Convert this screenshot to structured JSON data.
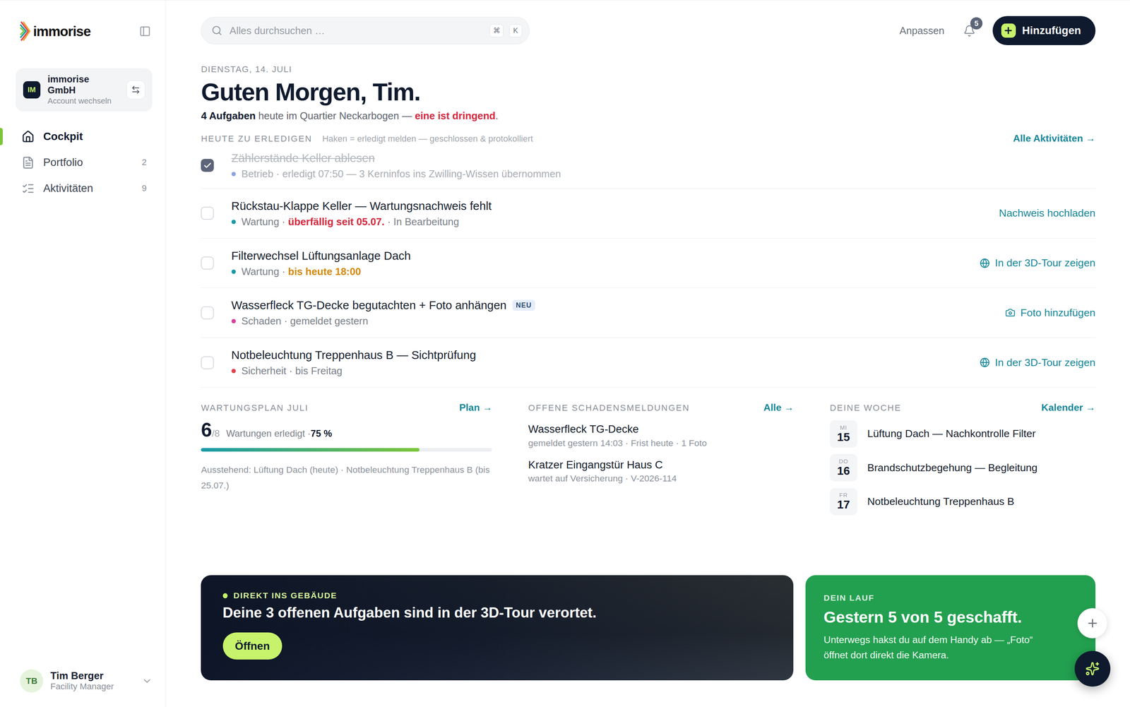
{
  "sidebar": {
    "logo": "immorise",
    "account": {
      "initials": "IM",
      "name": "immorise GmbH",
      "sub": "Account wechseln"
    },
    "items": [
      {
        "label": "Cockpit",
        "count": "",
        "selected": true,
        "kind": "home"
      },
      {
        "label": "Portfolio",
        "count": "2",
        "selected": false,
        "kind": "portfolio"
      },
      {
        "label": "Aktivitäten",
        "count": "9",
        "selected": false,
        "kind": "activities"
      }
    ],
    "user": {
      "initials": "TB",
      "name": "Tim Berger",
      "role": "Facility Manager"
    }
  },
  "topbar": {
    "search": {
      "placeholder": "Alles durchsuchen …",
      "keys": [
        "⌘",
        "K"
      ]
    },
    "customize": "Anpassen",
    "notifications": "5",
    "add": "Hinzufügen"
  },
  "greeting": {
    "date": "DIENSTAG, 14. JULI",
    "title": "Guten Morgen, Tim.",
    "summary": [
      {
        "text": "4 Aufgaben",
        "tone": "strong"
      },
      {
        "text": " heute im Quartier Neckarbogen — ",
        "tone": "normal"
      },
      {
        "text": "eine ist dringend",
        "tone": "urgent"
      },
      {
        "text": ".",
        "tone": "normal"
      }
    ]
  },
  "tasks": {
    "title": "HEUTE ZU ERLEDIGEN",
    "hint": "Haken = erledigt melden — geschlossen & protokolliert",
    "link": "Alle Aktivitäten →",
    "items": [
      {
        "title": "Zählerstände Keller ablesen",
        "checked": true,
        "badge": "",
        "category": "Betrieb",
        "color": "#8fa3e0",
        "meta": [
          {
            "text": " · erledigt 07:50 — 3 Kerninfos ins Zwilling-Wissen übernommen",
            "tone": "normal"
          }
        ],
        "action": {
          "label": "",
          "kind": "none"
        }
      },
      {
        "title": "Rückstau-Klappe Keller — Wartungsnachweis fehlt",
        "checked": false,
        "badge": "",
        "category": "Wartung",
        "color": "#1a9aa8",
        "meta": [
          {
            "text": " · ",
            "tone": "normal"
          },
          {
            "text": "überfällig seit 05.07.",
            "tone": "overdue"
          },
          {
            "text": " · In Bearbeitung",
            "tone": "normal"
          }
        ],
        "action": {
          "label": "Nachweis hochladen",
          "kind": "upload"
        }
      },
      {
        "title": "Filterwechsel Lüftungsanlage Dach",
        "checked": false,
        "badge": "",
        "category": "Wartung",
        "color": "#1a9aa8",
        "meta": [
          {
            "text": " · ",
            "tone": "normal"
          },
          {
            "text": "bis heute 18:00",
            "tone": "due"
          }
        ],
        "action": {
          "label": "In der 3D-Tour zeigen",
          "kind": "tour"
        }
      },
      {
        "title": "Wasserfleck TG-Decke begutachten + Foto anhängen",
        "checked": false,
        "badge": "NEU",
        "category": "Schaden",
        "color": "#d6409f",
        "meta": [
          {
            "text": " · gemeldet gestern",
            "tone": "normal"
          }
        ],
        "action": {
          "label": "Foto hinzufügen",
          "kind": "photo"
        }
      },
      {
        "title": "Notbeleuchtung Treppenhaus B — Sichtprüfung",
        "checked": false,
        "badge": "",
        "category": "Sicherheit",
        "color": "#e0424f",
        "meta": [
          {
            "text": " · bis Freitag",
            "tone": "normal"
          }
        ],
        "action": {
          "label": "In der 3D-Tour zeigen",
          "kind": "tour"
        }
      }
    ]
  },
  "maintenance": {
    "title": "WARTUNGSPLAN JULI",
    "link": "Plan →",
    "done": "6",
    "total": "/8",
    "label": "Wartungen erledigt · ",
    "percent": "75 %",
    "level": 0.75,
    "pending": "Ausstehend: Lüftung Dach (heute) · Notbeleuchtung Treppenhaus B (bis 25.07.)"
  },
  "damages": {
    "title": "OFFENE SCHADENSMELDUNGEN",
    "link": "Alle →",
    "items": [
      {
        "title": "Wasserfleck TG-Decke",
        "meta": "gemeldet gestern 14:03 · Frist heute · 1 Foto"
      },
      {
        "title": "Kratzer Eingangstür Haus C",
        "meta": "wartet auf Versicherung · V-2026-114"
      }
    ]
  },
  "week": {
    "title": "DEINE WOCHE",
    "link": "Kalender →",
    "items": [
      {
        "weekday": "MI",
        "day": "15",
        "label": "Lüftung Dach — Nachkontrolle Filter"
      },
      {
        "weekday": "DO",
        "day": "16",
        "label": "Brandschutzbegehung — Begleitung"
      },
      {
        "weekday": "FR",
        "day": "17",
        "label": "Notbeleuchtung Treppenhaus B"
      }
    ]
  },
  "tourBanner": {
    "eyebrow": "DIREKT INS GEBÄUDE",
    "title": "Deine 3 offenen Aufgaben sind in der 3D-Tour verortet.",
    "button": "Öffnen"
  },
  "streakBanner": {
    "eyebrow": "DEIN LAUF",
    "title": "Gestern 5 von 5 geschafft.",
    "text": "Unterwegs hakst du auf dem Handy ab — „Foto“ öffnet dort direkt die Kamera."
  }
}
